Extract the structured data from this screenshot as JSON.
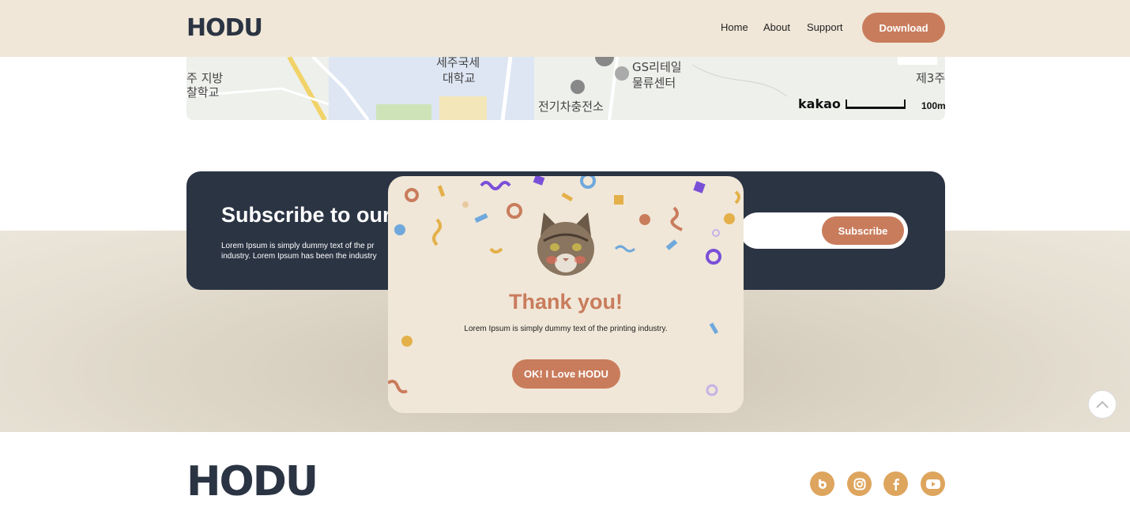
{
  "header": {
    "logo": "HODU",
    "nav": [
      "Home",
      "About",
      "Support"
    ],
    "download_label": "Download"
  },
  "map": {
    "labels": [
      "세주국세",
      "대학교",
      "주 지방",
      "찰학교",
      "GS리테일",
      "물류센터",
      "전기차충전소",
      "제3주"
    ],
    "brand": "kakao",
    "scale": "100m"
  },
  "subscribe": {
    "title": "Subscribe to our",
    "text_line1": "Lorem Ipsum is simply dummy text of the pr",
    "text_line2": "industry. Lorem Ipsum has been the industry",
    "button_label": "Subscribe"
  },
  "modal": {
    "title": "Thank you!",
    "text": "Lorem Ipsum is simply dummy text of the printing industry.",
    "button_label": "OK! I Love HODU"
  },
  "footer": {
    "logo": "HODU",
    "social": [
      "blog-icon",
      "instagram-icon",
      "facebook-icon",
      "youtube-icon"
    ]
  },
  "colors": {
    "cream": "#f0e7d8",
    "navy": "#2b3443",
    "accent": "#c97c5c",
    "social": "#dea55e"
  }
}
